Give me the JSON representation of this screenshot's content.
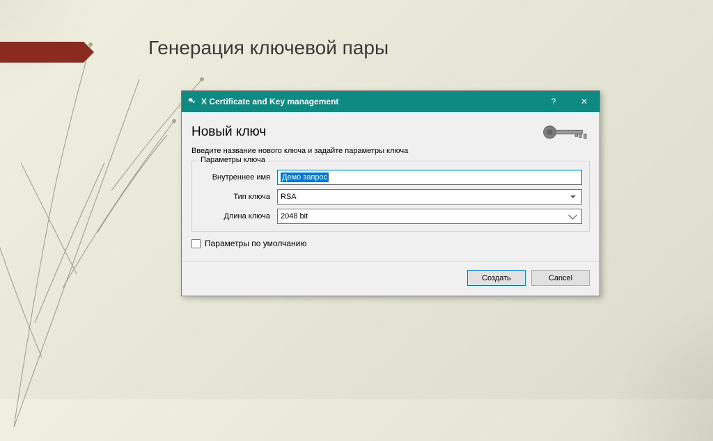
{
  "slide": {
    "title": "Генерация ключевой пары"
  },
  "dialog": {
    "title": "X Certificate and Key management",
    "heading": "Новый ключ",
    "instruction": "Введите название нового ключа и задайте параметры ключа",
    "group_title": "Параметры ключа",
    "fields": {
      "name_label": "Внутреннее имя",
      "name_value": "Демо запрос",
      "type_label": "Тип ключа",
      "type_value": "RSA",
      "length_label": "Длина ключа",
      "length_value": "2048 bit"
    },
    "defaults_checkbox": "Параметры по умолчанию",
    "buttons": {
      "create": "Создать",
      "cancel": "Cancel"
    },
    "help_glyph": "?",
    "close_glyph": "✕"
  }
}
